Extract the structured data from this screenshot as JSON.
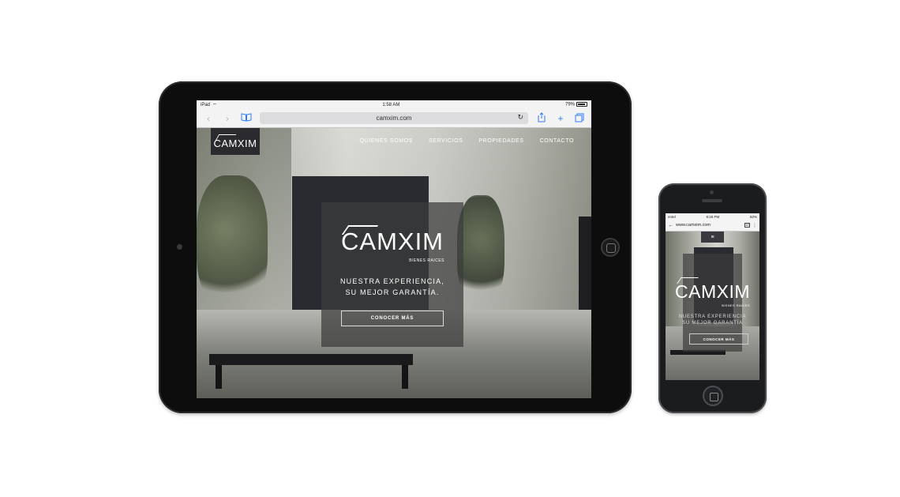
{
  "ipad": {
    "status": {
      "device": "iPad",
      "time": "1:58 AM",
      "battery": "79%"
    },
    "toolbar": {
      "back_icon": "chevron-left-icon",
      "forward_icon": "chevron-right-icon",
      "bookmarks_icon": "book-icon",
      "url": "camxim.com",
      "reload_icon": "reload-icon",
      "share_icon": "share-icon",
      "new_tab_icon": "plus-icon",
      "tabs_icon": "tabs-icon"
    },
    "site": {
      "logo": "CAMXIM",
      "nav": [
        "QUIENES SOMOS",
        "SERVICIOS",
        "PROPIEDADES",
        "CONTACTO"
      ],
      "hero": {
        "brand": "CAMXIM",
        "subtitle": "BIENES RAICES",
        "tagline_line1": "NUESTRA EXPERIENCIA,",
        "tagline_line2": "SU MEJOR GARANTÍA.",
        "button": "CONOCER MÁS"
      }
    }
  },
  "iphone": {
    "status": {
      "carrier": "entel",
      "time": "8:26 PM",
      "battery": "82%"
    },
    "toolbar": {
      "url": "www.camxim.com"
    },
    "site": {
      "menu": "≡",
      "hero": {
        "brand": "CAMXIM",
        "subtitle": "BIENES RAICES",
        "tagline_line1": "NUESTRA EXPERIENCIA",
        "tagline_line2": "SU MEJOR GARANTÍA",
        "button": "CONOCER MÁS"
      }
    }
  }
}
